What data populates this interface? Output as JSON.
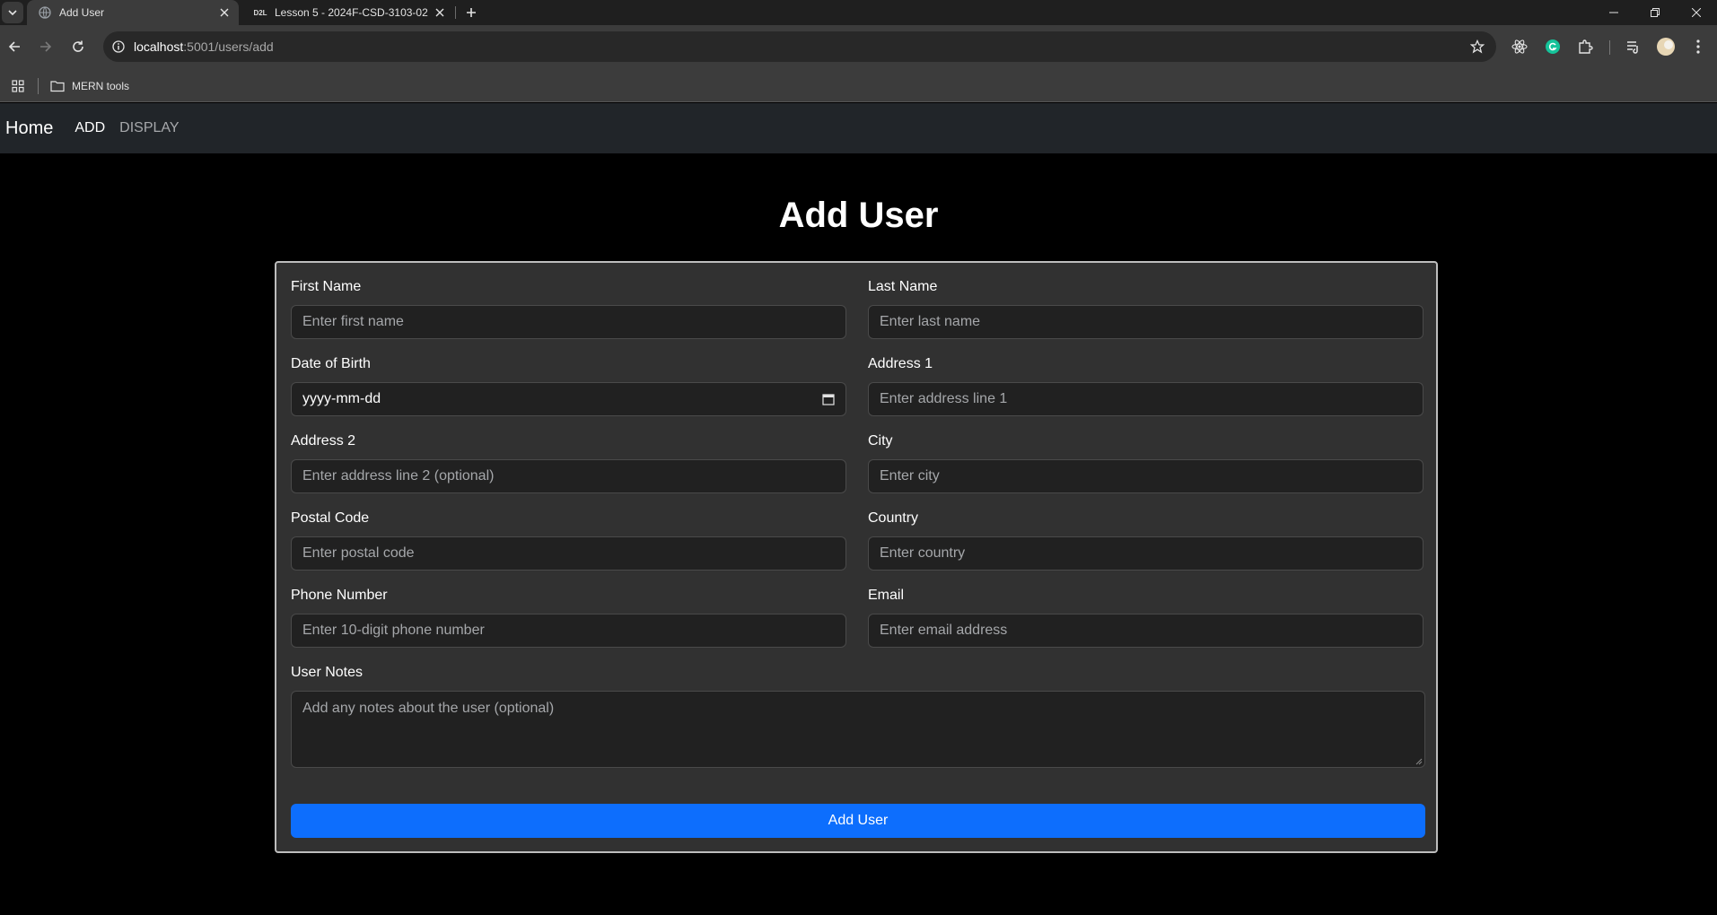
{
  "browser": {
    "tabs": [
      {
        "title": "Add User",
        "active": true
      },
      {
        "title": "Lesson 5 - 2024F-CSD-3103-02",
        "active": false,
        "favicon_text": "D2L"
      }
    ],
    "url": {
      "host": "localhost",
      "rest": ":5001/users/add"
    },
    "bookmarks": [
      {
        "label": "MERN tools",
        "icon": "folder-icon"
      }
    ]
  },
  "app": {
    "brand": "Home",
    "nav": [
      {
        "label": "ADD",
        "active": true
      },
      {
        "label": "DISPLAY",
        "active": false
      }
    ]
  },
  "page": {
    "title": "Add User",
    "fields": {
      "first_name": {
        "label": "First Name",
        "placeholder": "Enter first name"
      },
      "last_name": {
        "label": "Last Name",
        "placeholder": "Enter last name"
      },
      "dob": {
        "label": "Date of Birth",
        "value": "yyyy-mm-dd"
      },
      "address1": {
        "label": "Address 1",
        "placeholder": "Enter address line 1"
      },
      "address2": {
        "label": "Address 2",
        "placeholder": "Enter address line 2 (optional)"
      },
      "city": {
        "label": "City",
        "placeholder": "Enter city"
      },
      "postal": {
        "label": "Postal Code",
        "placeholder": "Enter postal code"
      },
      "country": {
        "label": "Country",
        "placeholder": "Enter country"
      },
      "phone": {
        "label": "Phone Number",
        "placeholder": "Enter 10-digit phone number"
      },
      "email": {
        "label": "Email",
        "placeholder": "Enter email address"
      },
      "notes": {
        "label": "User Notes",
        "placeholder": "Add any notes about the user (optional)"
      }
    },
    "submit_label": "Add User"
  },
  "colors": {
    "primary": "#0d6efd",
    "navbar_bg": "#212529",
    "card_bg": "#313131",
    "input_bg": "#212121",
    "page_bg": "#000000"
  }
}
